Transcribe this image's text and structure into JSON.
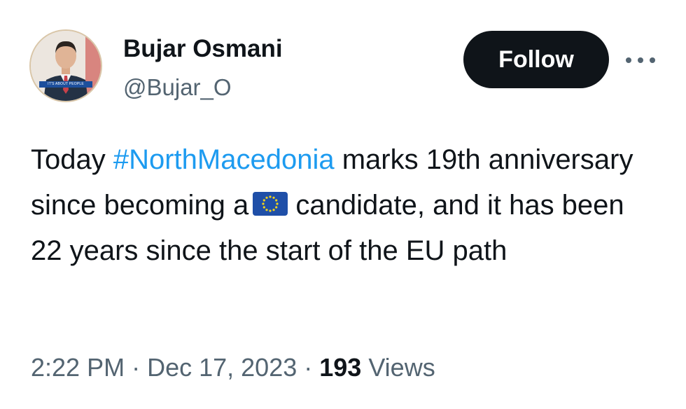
{
  "author": {
    "display_name": "Bujar Osmani",
    "handle": "@Bujar_O",
    "avatar_caption": "IT'S ABOUT PEOPLE"
  },
  "follow_button": {
    "label": "Follow"
  },
  "more_menu": {
    "icon": "more-horizontal-icon"
  },
  "tweet": {
    "text_before_hashtag": "Today ",
    "hashtag": "#NorthMacedonia",
    "text_after_hashtag": " marks 19th anniversary since becoming a",
    "emoji": "eu-flag-icon",
    "text_after_emoji": " candidate, and it has been 22 years since the start of the EU path"
  },
  "meta": {
    "time": "2:22 PM",
    "separator_1": " · ",
    "date": "Dec 17, 2023",
    "separator_2": " · ",
    "views_count": "193",
    "views_label": " Views"
  },
  "colors": {
    "text_primary": "#0f1419",
    "text_secondary": "#536471",
    "link": "#1d9bf0",
    "follow_bg": "#0f1419",
    "eu_blue": "#1f4fa8",
    "eu_star": "#f2d21b"
  }
}
